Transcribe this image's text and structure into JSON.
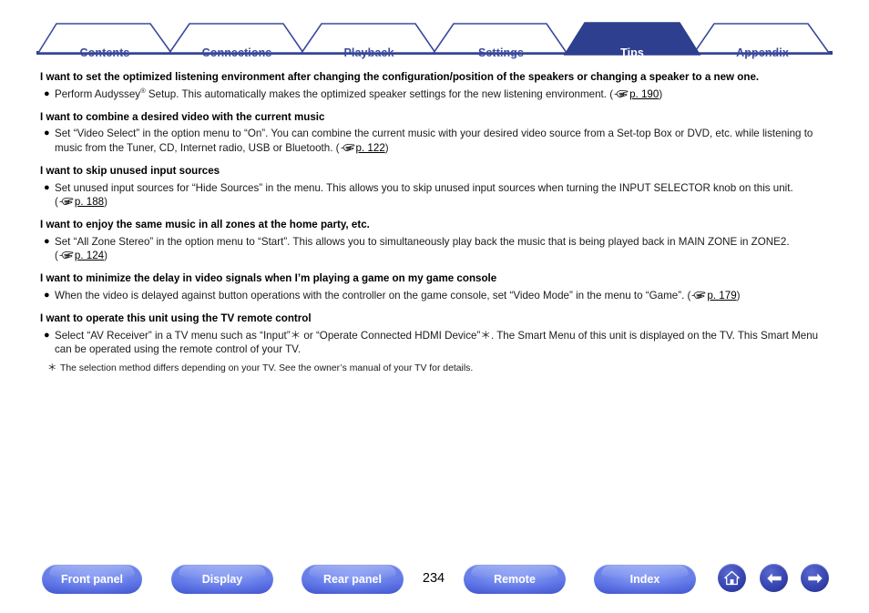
{
  "tabs": [
    {
      "label": "Contents",
      "active": false
    },
    {
      "label": "Connections",
      "active": false
    },
    {
      "label": "Playback",
      "active": false
    },
    {
      "label": "Settings",
      "active": false
    },
    {
      "label": "Tips",
      "active": true
    },
    {
      "label": "Appendix",
      "active": false
    }
  ],
  "colors": {
    "tab_active_bg": "#2e3f8f",
    "tab_border": "#3b4a9c",
    "tab_text_inactive": "#3b4a9c",
    "tab_text_active": "#ffffff",
    "button_blue": "#2f3da8"
  },
  "content": {
    "blocks": [
      {
        "heading": "I want to set the optimized listening environment after changing the configuration/position of the speakers or changing a speaker to a new one.",
        "items": [
          {
            "text_before": "Perform Audyssey",
            "superscript": "®",
            "text_after": " Setup. This automatically makes the optimized speaker settings for the new listening environment. ",
            "page_ref": "p. 190"
          }
        ]
      },
      {
        "heading": "I want to combine a desired video with the current music",
        "items": [
          {
            "text_before": "",
            "superscript": "",
            "text_after": "Set “Video Select” in the option menu to “On”. You can combine the current music with your desired video source from a Set-top Box or DVD, etc. while listening to music from the Tuner, CD, Internet radio, USB or Bluetooth. ",
            "page_ref": "p. 122"
          }
        ]
      },
      {
        "heading": "I want to skip unused input sources",
        "items": [
          {
            "text_before": "",
            "superscript": "",
            "text_after": "Set unused input sources for “Hide Sources” in the menu. This allows you to skip unused input sources when turning the INPUT SELECTOR knob on this unit. ",
            "page_ref": "p. 188"
          }
        ]
      },
      {
        "heading": "I want to enjoy the same music in all zones at the home party, etc.",
        "items": [
          {
            "text_before": "",
            "superscript": "",
            "text_after": "Set “All Zone Stereo” in the option menu to “Start”. This allows you to simultaneously play back the music that is being played back in MAIN ZONE in ZONE2. ",
            "page_ref": "p. 124"
          }
        ]
      },
      {
        "heading": "I want to minimize the delay in video signals when I’m playing a game on my game console",
        "items": [
          {
            "text_before": "",
            "superscript": "",
            "text_after": "When the video is delayed against button operations with the controller on the game console, set “Video Mode” in the menu to “Game”. ",
            "page_ref": "p. 179"
          }
        ]
      },
      {
        "heading": "I want to operate this unit using the TV remote control",
        "items": [
          {
            "text_before": "",
            "superscript": "",
            "text_after": "Select “AV Receiver” in a TV menu such as “Input”＊ or “Operate Connected HDMI Device”＊. The Smart Menu of this unit is displayed on the TV. This Smart Menu can be operated using the remote control of your TV.",
            "page_ref": ""
          }
        ],
        "note": "The selection method differs depending on your TV. See the owner’s manual of your TV for details."
      }
    ]
  },
  "footer": {
    "buttons": [
      {
        "label": "Front panel"
      },
      {
        "label": "Display"
      },
      {
        "label": "Rear panel"
      },
      {
        "label": "Remote"
      },
      {
        "label": "Index"
      }
    ],
    "page_number": "234",
    "icons": [
      {
        "name": "home-icon"
      },
      {
        "name": "back-arrow-icon"
      },
      {
        "name": "forward-arrow-icon"
      }
    ]
  }
}
